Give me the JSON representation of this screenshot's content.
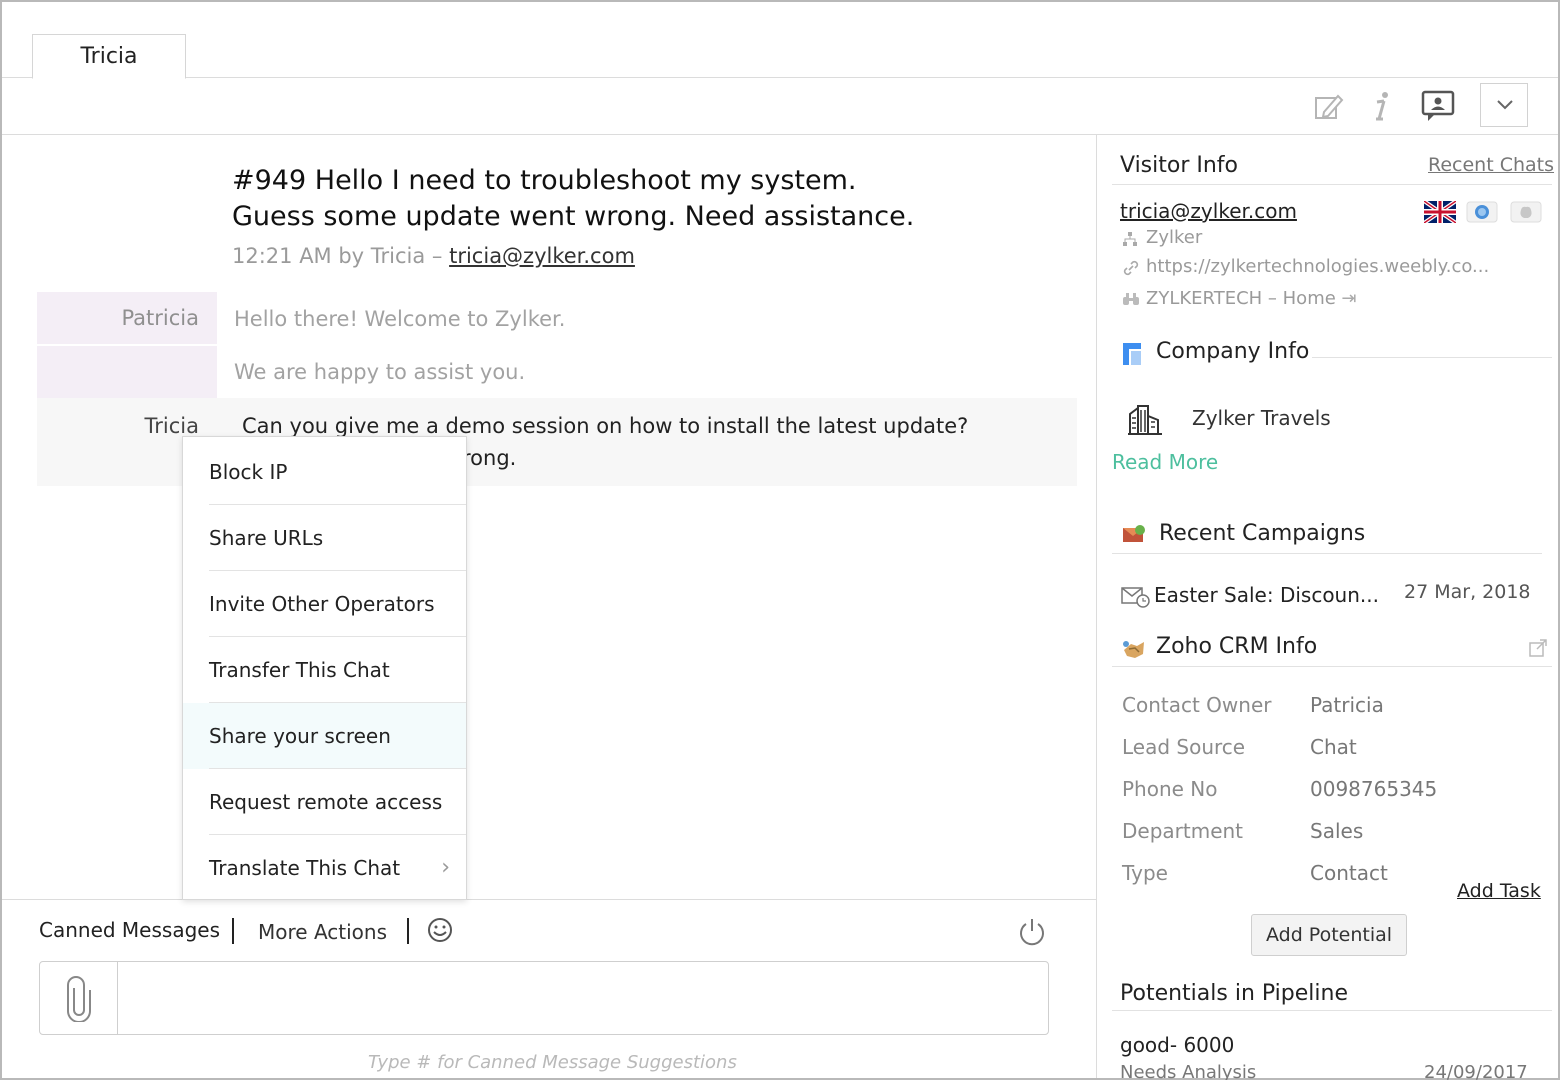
{
  "tab": {
    "label": "Tricia"
  },
  "chat": {
    "ticket_id": "#949",
    "title_line1": "Hello I need to troubleshoot my system.",
    "title_line2": "Guess some update went wrong. Need assistance.",
    "meta_prefix": "12:21 AM by Tricia –",
    "meta_email": "tricia@zylker.com",
    "messages": [
      {
        "sender": "Patricia",
        "text": "Hello there! Welcome to Zylker."
      },
      {
        "sender": "",
        "text": "We are happy to assist you."
      },
      {
        "sender": "Tricia",
        "line1": "Can you give me a demo session on how to install the latest update?",
        "line2_visible": "rong."
      }
    ]
  },
  "more_actions_menu": {
    "items": [
      {
        "label": "Block IP"
      },
      {
        "label": "Share URLs"
      },
      {
        "label": "Invite Other Operators"
      },
      {
        "label": "Transfer This Chat"
      },
      {
        "label": "Share your screen"
      },
      {
        "label": "Request remote access"
      },
      {
        "label": "Translate This Chat"
      }
    ]
  },
  "composer": {
    "canned_label": "Canned Messages",
    "more_actions_label": "More Actions",
    "hint": "Type # for Canned Message Suggestions"
  },
  "visitor_info": {
    "title": "Visitor Info",
    "recent_chats": "Recent Chats",
    "email": "tricia@zylker.com",
    "company": "Zylker",
    "url": "https://zylkertechnologies.weebly.co...",
    "page": "ZYLKERTECH – Home"
  },
  "company_info": {
    "title": "Company Info",
    "name": "Zylker Travels",
    "read_more": "Read More"
  },
  "recent_campaigns": {
    "title": "Recent Campaigns",
    "campaign": "Easter Sale: Discoun...",
    "date": "27 Mar, 2018"
  },
  "crm_info": {
    "title": "Zoho CRM Info",
    "rows": [
      {
        "label": "Contact Owner",
        "value": "Patricia"
      },
      {
        "label": "Lead Source",
        "value": "Chat"
      },
      {
        "label": "Phone No",
        "value": "0098765345"
      },
      {
        "label": "Department",
        "value": "Sales"
      },
      {
        "label": "Type",
        "value": "Contact"
      }
    ],
    "add_task": "Add Task",
    "add_potential": "Add Potential"
  },
  "potentials": {
    "title": "Potentials in Pipeline",
    "name": "good- 6000",
    "stage": "Needs Analysis",
    "date": "24/09/2017"
  },
  "colors": {
    "accent_green": "#4dbf9e",
    "operator_bg": "#f4eef6",
    "highlight_bg": "#f3fbfc"
  },
  "icons": [
    "edit-icon",
    "info-icon",
    "screen-share-icon",
    "chevron-down-icon",
    "emoji-icon",
    "power-icon",
    "paperclip-icon",
    "uk-flag-icon",
    "browser-icon",
    "apple-icon",
    "org-icon",
    "link-icon",
    "binoculars-icon",
    "company-info-icon",
    "building-icon",
    "campaign-icon",
    "email-clock-icon",
    "crm-icon",
    "external-link-icon",
    "chevron-right-icon"
  ]
}
